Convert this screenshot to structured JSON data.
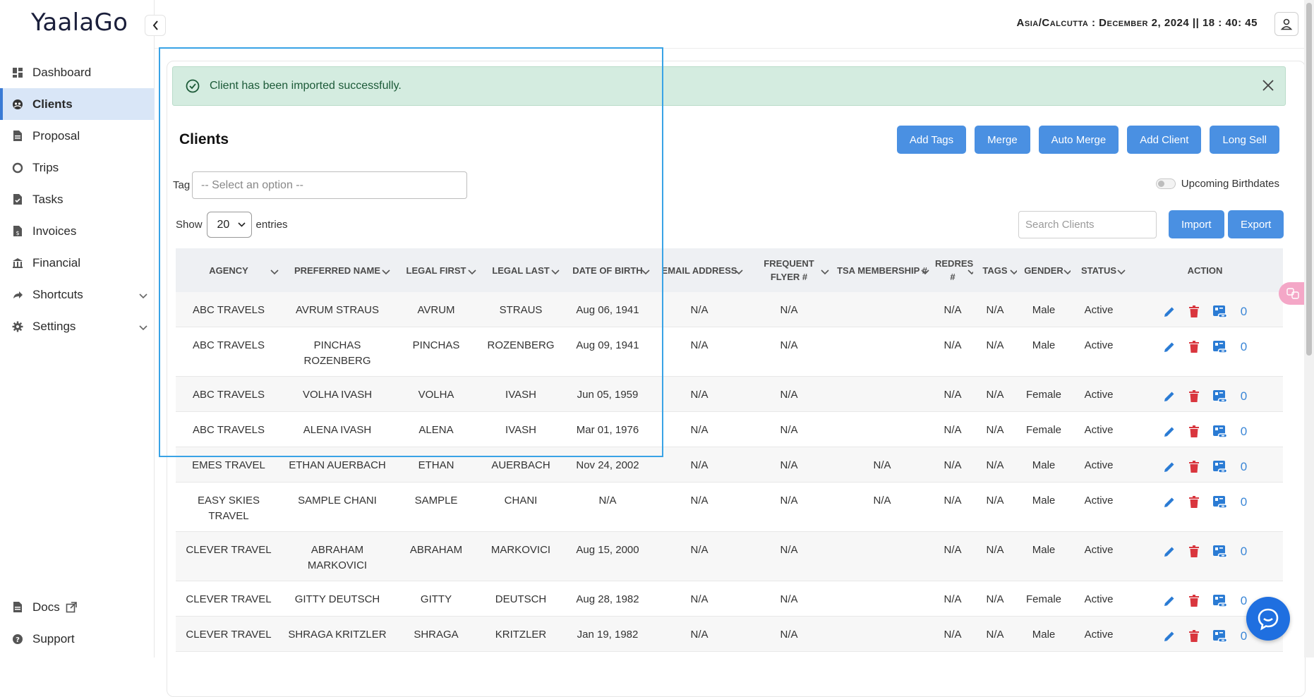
{
  "brand": "YaalaGo",
  "sidebar": {
    "items": [
      {
        "label": "Dashboard",
        "icon": "dashboard-icon"
      },
      {
        "label": "Clients",
        "icon": "clients-icon",
        "active": true
      },
      {
        "label": "Proposal",
        "icon": "document-icon"
      },
      {
        "label": "Trips",
        "icon": "circle-icon"
      },
      {
        "label": "Tasks",
        "icon": "task-icon"
      },
      {
        "label": "Invoices",
        "icon": "invoice-icon"
      },
      {
        "label": "Financial",
        "icon": "bank-icon"
      },
      {
        "label": "Shortcuts",
        "icon": "share-icon",
        "expandable": true
      },
      {
        "label": "Settings",
        "icon": "gear-icon",
        "expandable": true
      }
    ],
    "bottom": [
      {
        "label": "Docs",
        "icon": "document-icon"
      },
      {
        "label": "Support",
        "icon": "help-icon"
      }
    ]
  },
  "topbar": {
    "clock": "Asia/Calcutta : December 2, 2024 || 18 : 40: 45"
  },
  "alert": {
    "message": "Client has been imported successfully.",
    "color": "#d4ece0"
  },
  "page": {
    "title": "Clients",
    "buttons": [
      "Add Tags",
      "Merge",
      "Auto Merge",
      "Add Client",
      "Long Sell"
    ],
    "tag_label": "Tag",
    "tag_placeholder": "-- Select an option --",
    "birthday_label": "Upcoming Birthdates",
    "show_label": "Show",
    "entries_value": "20",
    "entries_label": "entries",
    "search_placeholder": "Search Clients",
    "import_label": "Import",
    "export_label": "Export",
    "accent": "#4a90e2"
  },
  "table": {
    "headers": [
      "AGENCY",
      "PREFERRED NAME",
      "LEGAL FIRST",
      "LEGAL LAST",
      "DATE OF BIRTH",
      "EMAIL ADDRESS",
      "FREQUENT FLYER #",
      "TSA MEMBERSHIP #",
      "REDRESS #",
      "TAGS",
      "GENDER",
      "STATUS",
      "ACTION"
    ],
    "rows": [
      [
        "ABC TRAVELS",
        "AVRUM STRAUS",
        "AVRUM",
        "STRAUS",
        "Aug 06, 1941",
        "N/A",
        "N/A",
        "",
        "N/A",
        "N/A",
        "Male",
        "Active",
        "0"
      ],
      [
        "ABC TRAVELS",
        "PINCHAS ROZENBERG",
        "PINCHAS",
        "ROZENBERG",
        "Aug 09, 1941",
        "N/A",
        "N/A",
        "",
        "N/A",
        "N/A",
        "Male",
        "Active",
        "0"
      ],
      [
        "ABC TRAVELS",
        "VOLHA IVASH",
        "VOLHA",
        "IVASH",
        "Jun 05, 1959",
        "N/A",
        "N/A",
        "",
        "N/A",
        "N/A",
        "Female",
        "Active",
        "0"
      ],
      [
        "ABC TRAVELS",
        "ALENA IVASH",
        "ALENA",
        "IVASH",
        "Mar 01, 1976",
        "N/A",
        "N/A",
        "",
        "N/A",
        "N/A",
        "Female",
        "Active",
        "0"
      ],
      [
        "EMES TRAVEL",
        "ETHAN AUERBACH",
        "ETHAN",
        "AUERBACH",
        "Nov 24, 2002",
        "N/A",
        "N/A",
        "N/A",
        "N/A",
        "N/A",
        "Male",
        "Active",
        "0"
      ],
      [
        "EASY SKIES TRAVEL",
        "SAMPLE CHANI",
        "SAMPLE",
        "CHANI",
        "N/A",
        "N/A",
        "N/A",
        "N/A",
        "N/A",
        "N/A",
        "Male",
        "Active",
        "0"
      ],
      [
        "CLEVER TRAVEL",
        "ABRAHAM MARKOVICI",
        "ABRAHAM",
        "MARKOVICI",
        "Aug 15, 2000",
        "N/A",
        "N/A",
        "",
        "N/A",
        "N/A",
        "Male",
        "Active",
        "0"
      ],
      [
        "CLEVER TRAVEL",
        "GITTY DEUTSCH",
        "GITTY",
        "DEUTSCH",
        "Aug 28, 1982",
        "N/A",
        "N/A",
        "",
        "N/A",
        "N/A",
        "Female",
        "Active",
        "0"
      ],
      [
        "CLEVER TRAVEL",
        "SHRAGA KRITZLER",
        "SHRAGA",
        "KRITZLER",
        "Jan 19, 1982",
        "N/A",
        "N/A",
        "",
        "N/A",
        "N/A",
        "Male",
        "Active",
        "0"
      ]
    ],
    "status_color": "#3a86d6",
    "delete_color": "#d9363e"
  }
}
